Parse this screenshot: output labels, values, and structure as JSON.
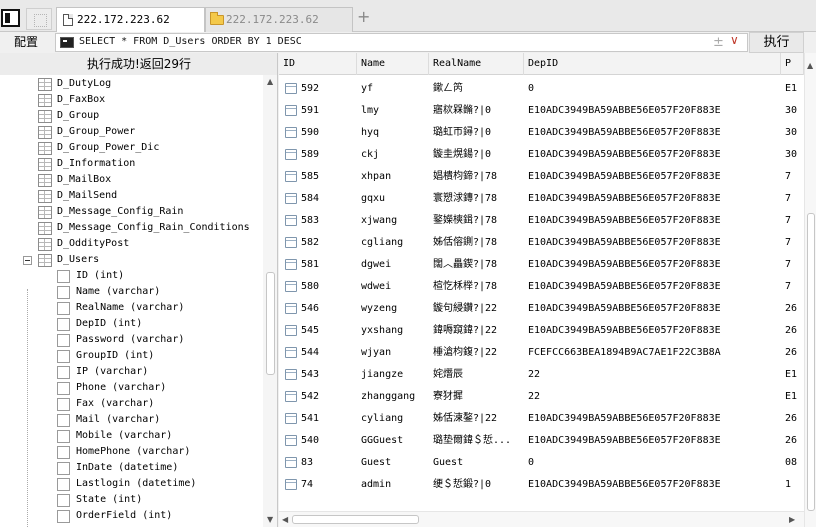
{
  "tabs": [
    {
      "label": "222.172.223.62",
      "active": true,
      "icon": "document-icon"
    },
    {
      "label": "222.172.223.62",
      "active": false,
      "icon": "folder-icon"
    }
  ],
  "new_tab_icon": "+",
  "toolbar": {
    "config_label": "配置",
    "sql_query": "SELECT * FROM D_Users ORDER BY 1 DESC",
    "plus_minus_icon": "±",
    "dropdown_icon": "∨",
    "run_label": "执行"
  },
  "status_text": "执行成功!返回29行",
  "tree": {
    "tables": [
      "D_DutyLog",
      "D_FaxBox",
      "D_Group",
      "D_Group_Power",
      "D_Group_Power_Dic",
      "D_Information",
      "D_MailBox",
      "D_MailSend",
      "D_Message_Config_Rain",
      "D_Message_Config_Rain_Conditions",
      "D_OddityPost"
    ],
    "expanded_table": "D_Users",
    "columns": [
      "ID (int)",
      "Name (varchar)",
      "RealName (varchar)",
      "DepID (int)",
      "Password (varchar)",
      "GroupID (int)",
      "IP (varchar)",
      "Phone (varchar)",
      "Fax (varchar)",
      "Mail (varchar)",
      "Mobile (varchar)",
      "HomePhone (varchar)",
      "InDate (datetime)",
      "Lastlogin (datetime)",
      "State (int)",
      "OrderField (int)"
    ]
  },
  "grid": {
    "headers": [
      "ID",
      "Name",
      "RealName",
      "DepID",
      "P"
    ],
    "rows": [
      [
        "592",
        "yf",
        "鏉ㄥ笍",
        "0",
        "E1"
      ],
      [
        "591",
        "lmy",
        "寤栨槑鏅?|0",
        "E10ADC3949BA59ABBE56E057F20F883E",
        "30"
      ],
      [
        "590",
        "hyq",
        "璐虹帀鐞?|0",
        "E10ADC3949BA59ABBE56E057F20F883E",
        "30"
      ],
      [
        "589",
        "ckj",
        "鏇圭熀鍚?|0",
        "E10ADC3949BA59ABBE56E057F20F883E",
        "30"
      ],
      [
        "585",
        "xhpan",
        "娼樻枃鍗?|78",
        "E10ADC3949BA59ABBE56E057F20F883E",
        "7"
      ],
      [
        "584",
        "gqxu",
        "寰愬浗鏄?|78",
        "E10ADC3949BA59ABBE56E057F20F883E",
        "7"
      ],
      [
        "583",
        "xjwang",
        "鐜嬫樉鍓?|78",
        "E10ADC3949BA59ABBE56E057F20F883E",
        "7"
      ],
      [
        "582",
        "cgliang",
        "姊佸傛鍘?|78",
        "E10ADC3949BA59ABBE56E057F20F883E",
        "7"
      ],
      [
        "581",
        "dgwei",
        "闊︿畾鍥?|78",
        "E10ADC3949BA59ABBE56E057F20F883E",
        "7"
      ],
      [
        "580",
        "wdwei",
        "楦忔柇榉?|78",
        "E10ADC3949BA59ABBE56E057F20F883E",
        "7"
      ],
      [
        "546",
        "wyzeng",
        "鏇句綅鑽?|22",
        "E10ADC3949BA59ABBE56E057F20F883E",
        "26"
      ],
      [
        "545",
        "yxshang",
        "鍏嗕竀鍏?|22",
        "E10ADC3949BA59ABBE56E057F20F883E",
        "26"
      ],
      [
        "544",
        "wjyan",
        "棰滄枃鍑?|22",
        "FCEFCC663BEA1894B9AC7AE1F22C3B8A",
        "26"
      ],
      [
        "543",
        "jiangze",
        "姹熸辰",
        "22",
        "E1"
      ],
      [
        "542",
        "zhanggang",
        "寮犲摨",
        "22",
        "E1"
      ],
      [
        "541",
        "cyliang",
        "姊佸湅鏊?|22",
        "E10ADC3949BA59ABBE56E057F20F883E",
        "26"
      ],
      [
        "540",
        "GGGuest",
        "璐垫爾鍏＄悊...",
        "E10ADC3949BA59ABBE56E057F20F883E",
        "26"
      ],
      [
        "83",
        "Guest",
        "Guest",
        "0",
        "08"
      ],
      [
        "74",
        "admin",
        "绠＄悊鍛?|0",
        "E10ADC3949BA59ABBE56E057F20F883E",
        "1"
      ]
    ]
  },
  "icons": {
    "table": "table-icon",
    "column": "column-icon",
    "row": "row-icon",
    "collapse": "collapse-minus-icon",
    "terminal": "terminal-icon"
  },
  "colors": {
    "dropdown_accent": "#c0392b",
    "folder": "#f4c94a"
  }
}
